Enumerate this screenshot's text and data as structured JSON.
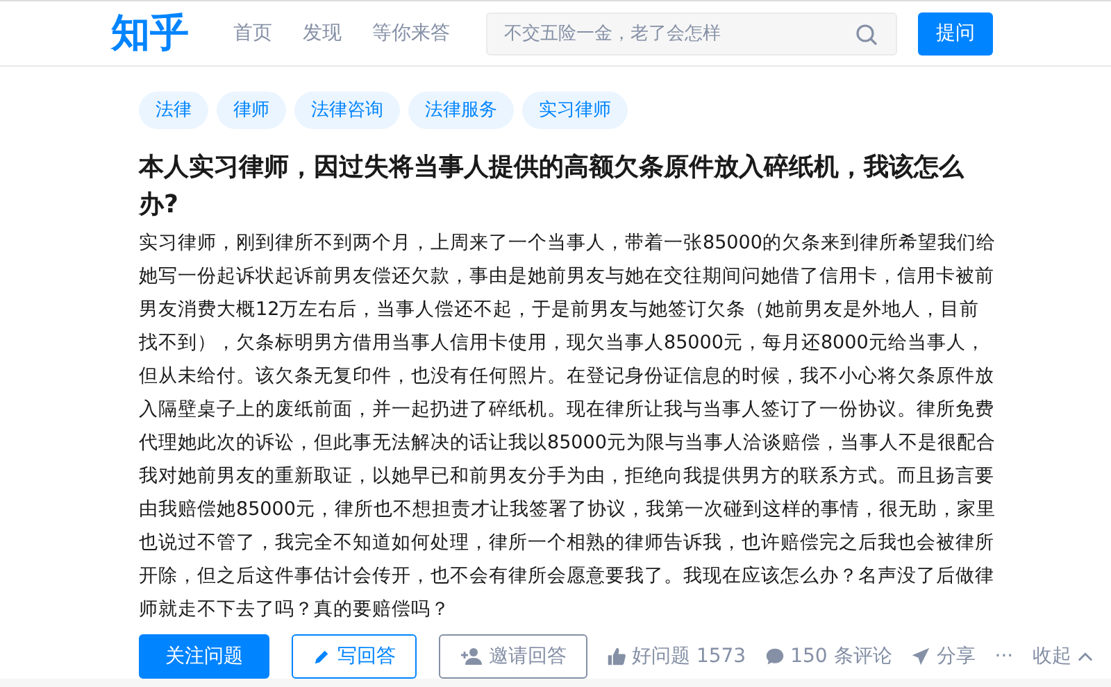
{
  "header": {
    "logo": "知乎",
    "nav": [
      {
        "label": "首页"
      },
      {
        "label": "发现"
      },
      {
        "label": "等你来答"
      }
    ],
    "search": {
      "placeholder": "不交五险一金，老了会怎样"
    },
    "ask_button": "提问"
  },
  "question": {
    "tags": [
      "法律",
      "律师",
      "法律咨询",
      "法律服务",
      "实习律师"
    ],
    "title": "本人实习律师，因过失将当事人提供的高额欠条原件放入碎纸机，我该怎么办?",
    "body": "实习律师，刚到律所不到两个月，上周来了一个当事人，带着一张85000的欠条来到律所希望我们给她写一份起诉状起诉前男友偿还欠款，事由是她前男友与她在交往期间问她借了信用卡，信用卡被前男友消费大概12万左右后，当事人偿还不起，于是前男友与她签订欠条（她前男友是外地人，目前找不到），欠条标明男方借用当事人信用卡使用，现欠当事人85000元，每月还8000元给当事人，但从未给付。该欠条无复印件，也没有任何照片。在登记身份证信息的时候，我不小心将欠条原件放入隔壁桌子上的废纸前面，并一起扔进了碎纸机。现在律所让我与当事人签订了一份协议。律所免费代理她此次的诉讼，但此事无法解决的话让我以85000元为限与当事人洽谈赔偿，当事人不是很配合我对她前男友的重新取证，以她早已和前男友分手为由，拒绝向我提供男方的联系方式。而且扬言要由我赔偿她85000元，律所也不想担责才让我签署了协议，我第一次碰到这样的事情，很无助，家里也说过不管了，我完全不知道如何处理，律所一个相熟的律师告诉我，也许赔偿完之后我也会被律所开除，但之后这件事估计会传开，也不会有律所会愿意要我了。我现在应该怎么办？名声没了后做律师就走不下去了吗？真的要赔偿吗？",
    "actions": [
      {
        "kind": "primary",
        "label": "关注问题"
      },
      {
        "kind": "write",
        "label": "写回答"
      },
      {
        "kind": "invite",
        "label": "邀请回答"
      },
      {
        "kind": "like",
        "label": "好问题 1573"
      },
      {
        "kind": "comment",
        "label": "150 条评论"
      },
      {
        "kind": "share",
        "label": "分享"
      },
      {
        "kind": "more",
        "label": "···"
      },
      {
        "kind": "collapse",
        "label": "收起"
      }
    ]
  }
}
